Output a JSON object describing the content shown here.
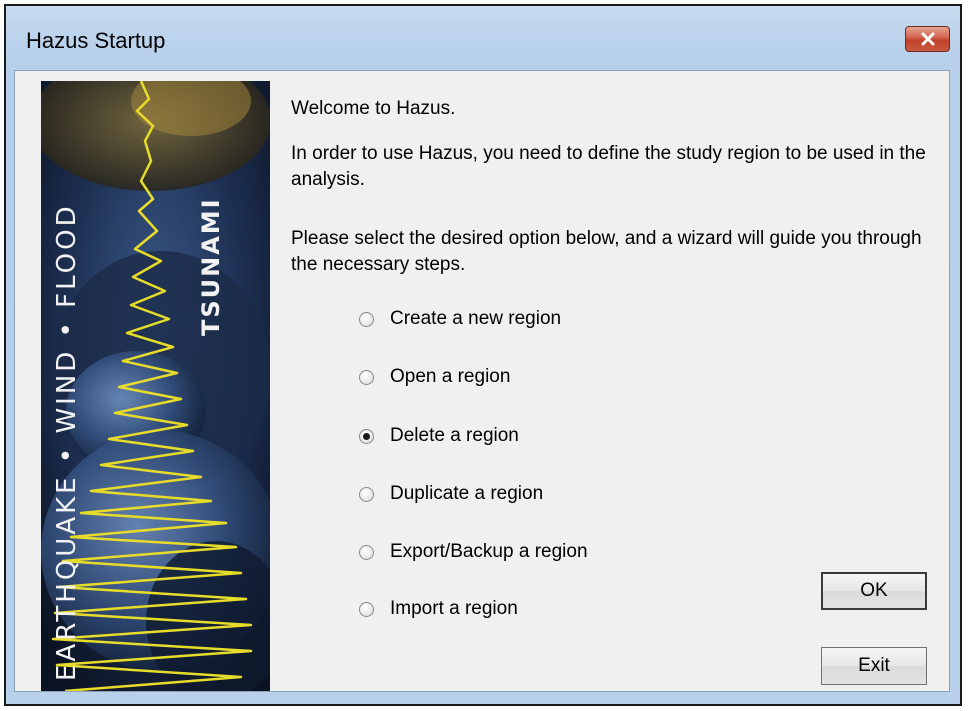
{
  "window": {
    "title": "Hazus Startup"
  },
  "banner": {
    "vertical_text": "EARTHQUAKE • WIND • FLOOD",
    "tsunami_text": "TSUNAMI"
  },
  "content": {
    "welcome": "Welcome to Hazus.",
    "intro": "In order to use Hazus, you need to define the study region to be used in the analysis.",
    "instruction": "Please select the desired option below, and a wizard will guide you through the necessary steps."
  },
  "options": [
    {
      "label": "Create a new region",
      "selected": false
    },
    {
      "label": "Open a region",
      "selected": false
    },
    {
      "label": "Delete a region",
      "selected": true
    },
    {
      "label": "Duplicate a region",
      "selected": false
    },
    {
      "label": "Export/Backup a region",
      "selected": false
    },
    {
      "label": "Import a region",
      "selected": false
    }
  ],
  "buttons": {
    "ok_label": "OK",
    "exit_label": "Exit"
  },
  "colors": {
    "banner_text": "#f2f2f2",
    "seismograph": "#e8dc2a",
    "title_gradient": "#c9dcf0"
  },
  "icons": {
    "close": "close-x-icon",
    "radio": "radio-button-icon"
  }
}
